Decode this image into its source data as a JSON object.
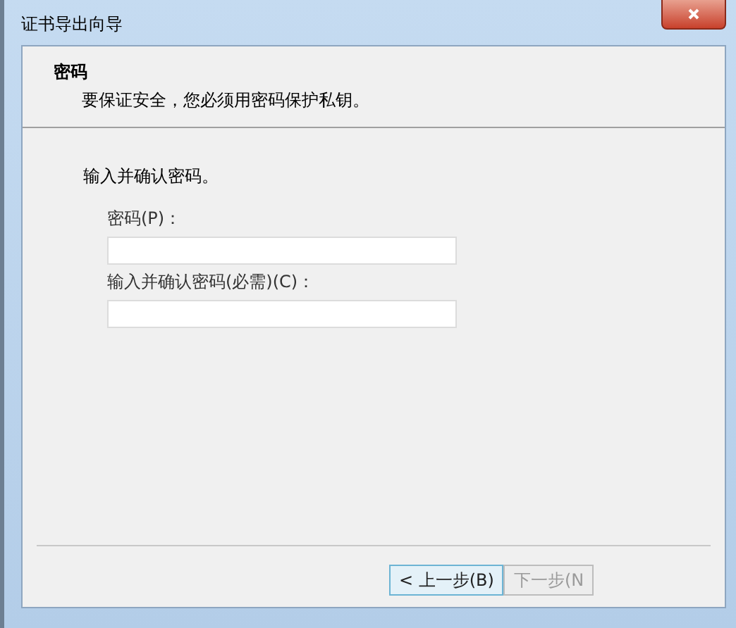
{
  "window": {
    "title": "证书导出向导"
  },
  "header": {
    "title": "密码",
    "subtitle": "要保证安全，您必须用密码保护私钥。"
  },
  "intro": "输入并确认密码。",
  "fields": [
    {
      "label": "密码(P)："
    },
    {
      "label": "输入并确认密码(必需)(C)："
    }
  ],
  "buttons": [
    {
      "label": "< 上一步(B)",
      "disabled": false,
      "selected": true
    },
    {
      "label": "下一步(N",
      "disabled": true,
      "selected": false
    }
  ]
}
